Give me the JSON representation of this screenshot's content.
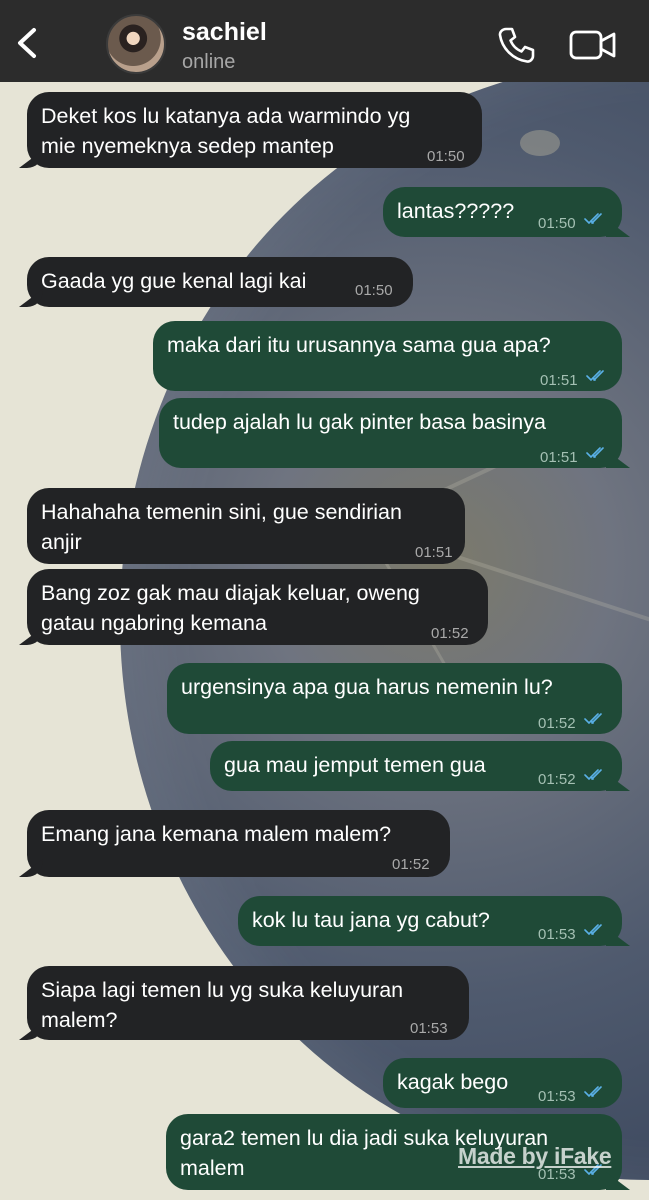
{
  "contact": {
    "name": "sachiel",
    "status": "online"
  },
  "icons": {
    "back": "chevron-left-icon",
    "call": "phone-icon",
    "video": "video-camera-icon"
  },
  "colors": {
    "header": "#2c2c2c",
    "incoming": "#222325",
    "outgoing": "#1f4a37",
    "read_ticks": "#5ab0e6"
  },
  "messages": [
    {
      "dir": "in",
      "text": "Deket kos lu katanya ada warmindo yg\nmie nyemeknya sedep mantep",
      "time": "01:50"
    },
    {
      "dir": "out",
      "text": "lantas?????",
      "time": "01:50",
      "read": true
    },
    {
      "dir": "in",
      "text": "Gaada yg gue kenal lagi kai",
      "time": "01:50"
    },
    {
      "dir": "out",
      "text": "maka dari itu urusannya sama gua apa?",
      "time": "01:51",
      "read": true
    },
    {
      "dir": "out",
      "text": "tudep ajalah lu gak pinter basa basinya",
      "time": "01:51",
      "read": true
    },
    {
      "dir": "in",
      "text": "Hahahaha temenin sini, gue sendirian\nanjir",
      "time": "01:51"
    },
    {
      "dir": "in",
      "text": "Bang zoz gak mau diajak keluar, oweng\ngatau ngabring kemana",
      "time": "01:52"
    },
    {
      "dir": "out",
      "text": "urgensinya apa gua harus nemenin lu?",
      "time": "01:52",
      "read": true
    },
    {
      "dir": "out",
      "text": "gua mau jemput temen gua",
      "time": "01:52",
      "read": true
    },
    {
      "dir": "in",
      "text": "Emang jana kemana malem malem?",
      "time": "01:52"
    },
    {
      "dir": "out",
      "text": "kok lu tau jana yg cabut?",
      "time": "01:53",
      "read": true
    },
    {
      "dir": "in",
      "text": "Siapa lagi temen lu yg suka keluyuran\nmalem?",
      "time": "01:53"
    },
    {
      "dir": "out",
      "text": "kagak bego",
      "time": "01:53",
      "read": true
    },
    {
      "dir": "out",
      "text": "gara2 temen lu dia jadi suka keluyuran\nmalem",
      "time": "01:53",
      "read": true
    }
  ],
  "watermark": "Made by iFake"
}
